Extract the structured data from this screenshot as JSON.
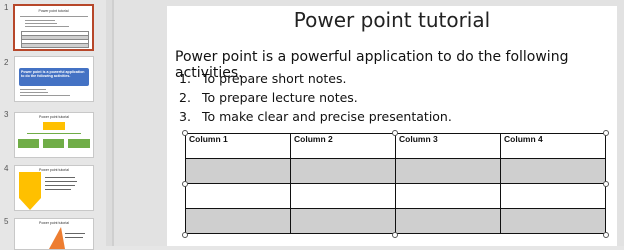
{
  "thumbnails": [
    {
      "number": "1",
      "title": "Power point tutorial",
      "lines": [
        "Power point is a powerful application to do the following activities.",
        "To prepare short notes.",
        "To prepare lecture notes.",
        "To make clear and precise presentation."
      ],
      "active": true
    },
    {
      "number": "2",
      "title": "Power point is a powerful application to do the following activities.",
      "bullets": [
        "To prepare short notes",
        "To prepare lecture notes",
        "To make clear and precise presentation"
      ],
      "accent": "#4472c4"
    },
    {
      "number": "3",
      "title": "Power point tutorial",
      "boxes": [
        "To prepare short notes",
        "To prepare lecture notes",
        "To make clear and precise presentation"
      ],
      "accent": "#70ad47"
    },
    {
      "number": "4",
      "title": "Power point tutorial",
      "bullets": [
        "To prepare short notes",
        "To prepare lecture notes",
        "To make clear and precise presentation"
      ],
      "accent": "#ffc000"
    },
    {
      "number": "5",
      "title": "Power point tutorial",
      "accent": "#ed7d31"
    }
  ],
  "slide": {
    "title": "Power point tutorial",
    "body": "Power point is a powerful application to do the following activities.",
    "list": [
      {
        "n": "1.",
        "text": "To prepare short notes."
      },
      {
        "n": "2.",
        "text": "To prepare lecture notes."
      },
      {
        "n": "3.",
        "text": "To make clear and precise presentation."
      }
    ],
    "table": {
      "headers": [
        "Column 1",
        "Column 2",
        "Column 3",
        "Column 4"
      ],
      "rows": [
        [
          "",
          "",
          "",
          ""
        ],
        [
          "",
          "",
          "",
          ""
        ],
        [
          "",
          "",
          "",
          ""
        ]
      ]
    }
  }
}
